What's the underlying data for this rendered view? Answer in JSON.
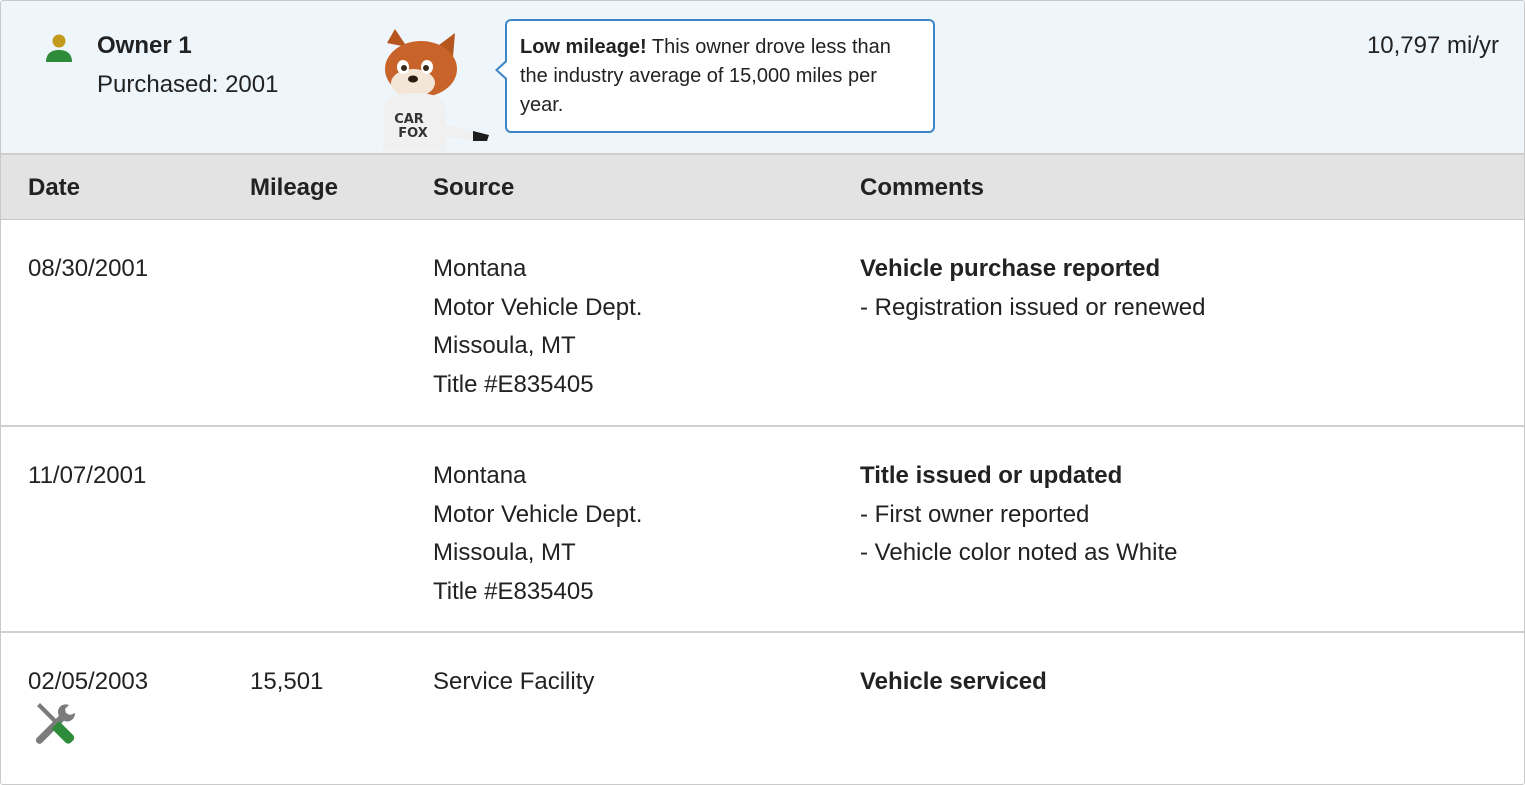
{
  "owner": {
    "title": "Owner 1",
    "purchased": "Purchased: 2001",
    "mileage_per_year": "10,797 mi/yr",
    "person_icon_color": "#2e8b3a",
    "callout": {
      "bold": "Low mileage!",
      "text": " This owner drove less than the industry average of 15,000 miles per year."
    },
    "mascot_shirt_text": [
      "CAR",
      "FOX"
    ]
  },
  "table": {
    "headers": {
      "date": "Date",
      "mileage": "Mileage",
      "source": "Source",
      "comments": "Comments"
    },
    "rows": [
      {
        "date": "08/30/2001",
        "mileage": "",
        "source": [
          "Montana",
          "Motor Vehicle Dept.",
          "Missoula, MT",
          "Title #E835405"
        ],
        "comment_title": "Vehicle purchase reported",
        "comment_lines": [
          "- Registration issued or renewed"
        ]
      },
      {
        "date": "11/07/2001",
        "mileage": "",
        "source": [
          "Montana",
          "Motor Vehicle Dept.",
          "Missoula, MT",
          "Title #E835405"
        ],
        "comment_title": "Title issued or updated",
        "comment_lines": [
          "- First owner reported",
          "- Vehicle color noted as White"
        ]
      },
      {
        "date": "02/05/2003",
        "mileage": "15,501",
        "source": [
          "Service Facility"
        ],
        "comment_title": "Vehicle serviced",
        "comment_lines": [],
        "icon": "wrench-screwdriver-icon"
      }
    ]
  },
  "colors": {
    "header_bg": "#eef5fb",
    "callout_border": "#3f86c6",
    "table_head_bg": "#e3e3e3",
    "service_icon_green": "#2e8b3a"
  }
}
